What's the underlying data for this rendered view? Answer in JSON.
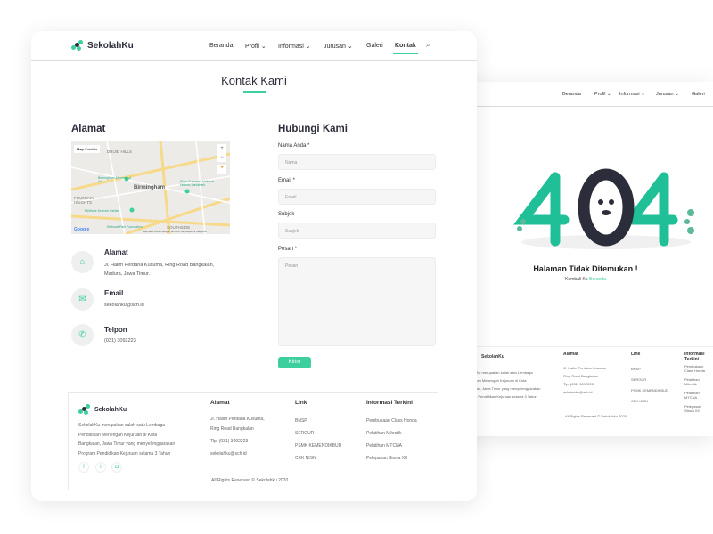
{
  "brand": {
    "name": "SekolahKu",
    "accent": "#3ecf9e",
    "dark": "#2b2d3a"
  },
  "nav": {
    "items": [
      "Beranda",
      "Profil",
      "Informasi",
      "Jurusan",
      "Galeri",
      "Kontak"
    ],
    "active": "Kontak",
    "search_icon": "search-icon"
  },
  "contact_page": {
    "title": "Kontak Kami",
    "address_heading": "Alamat",
    "map": {
      "map_tab": "Map",
      "satellite_tab": "Satellite",
      "city": "Birmingham",
      "labels": [
        "DRUID HILLS",
        "Birmingham Museum of Art",
        "Sloss Furnaces National Historic Landmark",
        "FOUNTAIN HEIGHTS",
        "McWane Science Center",
        "Railroad Park Foundation",
        "SOUTHSIDE"
      ],
      "footer": "Map data ©2019 Google  Terms of Use  Report a map error",
      "google": "Google"
    },
    "info": [
      {
        "icon": "home-icon",
        "title": "Alamat",
        "text": "Jl. Halim Perdana Kusuma, Ring Road Bangkalan,",
        "text2": "Madura, Jawa Timur."
      },
      {
        "icon": "mail-icon",
        "title": "Email",
        "text": "sekolahku@sch.id"
      },
      {
        "icon": "phone-icon",
        "title": "Telpon",
        "text": "(031) 3092223"
      }
    ],
    "form": {
      "heading": "Hubungi Kami",
      "name_label": "Nama Anda *",
      "name_placeholder": "Nama",
      "email_label": "Email *",
      "email_placeholder": "Email",
      "subject_label": "Subjek",
      "subject_placeholder": "Subjek",
      "message_label": "Pesan *",
      "message_placeholder": "Pesan",
      "submit": "Kirim"
    }
  },
  "footer": {
    "about": [
      "SekolahKu  merupakan salah satu Lembaga",
      "Pendidikan Menengah Kejuruan di Kota",
      "Bangkalan, Jawa Timur yang menyelenggarakan",
      "Program Pendidikan Kejuruan selama 3 Tahun"
    ],
    "address_heading": "Alamat",
    "address": [
      "Jl. Halim Perdana Kusuma,",
      "Ring Road Bangkalan",
      "Tlp. (031) 3092223",
      "sekolahku@sch.id"
    ],
    "link_heading": "Link",
    "links": [
      "BNSP",
      "SERGUR",
      "PSMK KEMENDIKBUD",
      "CEK NISN"
    ],
    "news_heading": "Informasi Terkini",
    "news": [
      "Pembukaan Class Honda",
      "Pelatihan Mikrotik",
      "Pelatihan MTCNA",
      "Pelepasan Siswa XII"
    ],
    "social": [
      "facebook-icon",
      "twitter-icon",
      "instagram-icon"
    ],
    "copyright": "All Rights Reserved © Sekolahku 2020"
  },
  "notfound_page": {
    "code": "404",
    "title": "Halaman Tidak Ditemukan !",
    "back_text": "Kembali Ke",
    "back_link": "Beranda"
  }
}
